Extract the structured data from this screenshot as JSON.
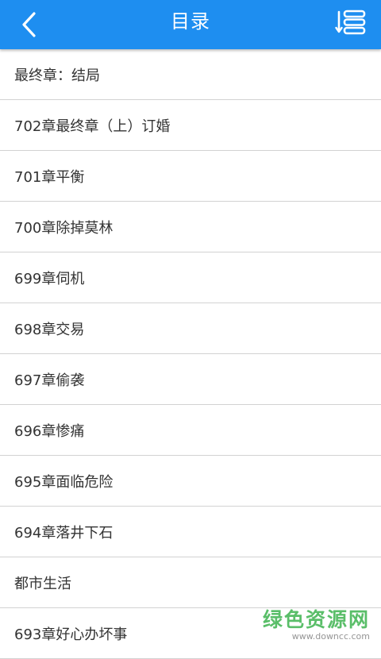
{
  "header": {
    "title": "目录",
    "background": "#1e8ef0",
    "back_icon": "chevron-left-icon",
    "sort_icon": "sort-list-icon"
  },
  "chapters": [
    {
      "label": "最终章：结局"
    },
    {
      "label": "702章最终章（上）订婚"
    },
    {
      "label": "701章平衡"
    },
    {
      "label": "700章除掉莫林"
    },
    {
      "label": "699章伺机"
    },
    {
      "label": "698章交易"
    },
    {
      "label": "697章偷袭"
    },
    {
      "label": "696章惨痛"
    },
    {
      "label": "695章面临危险"
    },
    {
      "label": "694章落井下石"
    },
    {
      "label": "都市生活"
    },
    {
      "label": "693章好心办坏事"
    }
  ],
  "watermark": {
    "text": "绿色资源网",
    "url": "www.downcc.com",
    "color": "#49b859"
  }
}
